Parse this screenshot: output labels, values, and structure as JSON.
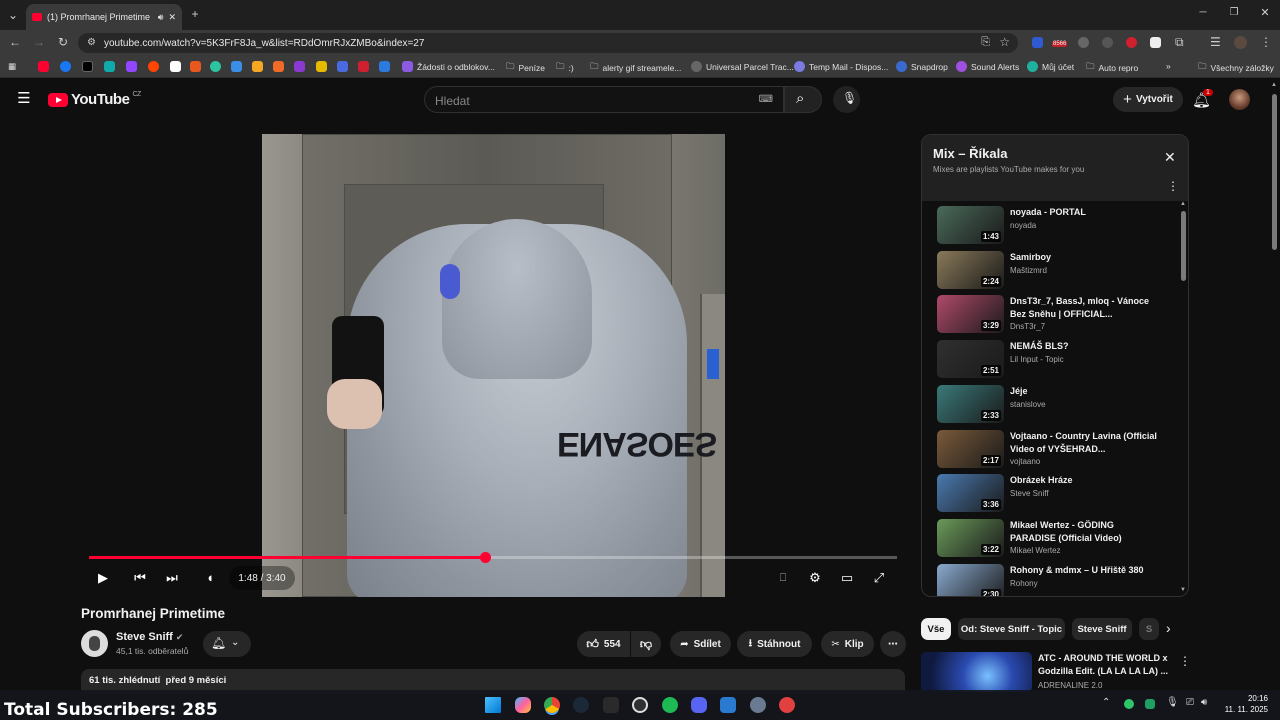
{
  "browser": {
    "tab_title": "(1) Promrhanej Primetime -",
    "url": "youtube.com/watch?v=5K3FrF8Ja_w&list=RDdOmrRJxZMBo&index=27",
    "bookmarks": [
      "Žádosti o odblokov...",
      "Peníze",
      ":)",
      "alerty gif streamele...",
      "Universal Parcel Trac...",
      "Temp Mail - Dispos...",
      "Snapdrop",
      "Sound Alerts",
      "Můj účet",
      "Auto repro"
    ],
    "all_bookmarks": "Všechny záložky",
    "ext_badge": "8566"
  },
  "header": {
    "logo": "YouTube",
    "region": "CZ",
    "search_placeholder": "Hledat",
    "create_label": "Vytvořit",
    "notif_count": "1"
  },
  "player": {
    "time": "1:48 / 3:40",
    "progress": 0.49
  },
  "video": {
    "title": "Promrhanej Primetime",
    "channel": "Steve Sniff",
    "subscribers": "45,1 tis. odběratelů",
    "likes": "554",
    "share": "Sdílet",
    "download": "Stáhnout",
    "clip": "Klip",
    "views": "61 tis. zhlédnutí  před 9 měsíci",
    "hoodie_text": "ENASOES"
  },
  "playlist": {
    "title": "Mix – Říkala",
    "subtitle": "Mixes are playlists YouTube makes for you",
    "items": [
      {
        "title": "noyada - PORTAL",
        "channel": "noyada",
        "duration": "1:43",
        "color": "#4a6a5a"
      },
      {
        "title": "Samirboy",
        "channel": "Maštizmrd",
        "duration": "2:24",
        "color": "#8a7a5a"
      },
      {
        "title": "DnsT3r_7, BassJ, mloq - Vánoce Bez Sněhu | OFFICIAL...",
        "channel": "DnsT3r_7",
        "duration": "3:29",
        "color": "#b04a6a"
      },
      {
        "title": "NEMÁŠ BLS?",
        "channel": "Lil Input - Topic",
        "duration": "2:51",
        "color": "#303030"
      },
      {
        "title": "Jéje",
        "channel": "stanislove",
        "duration": "2:33",
        "color": "#3a7a7a"
      },
      {
        "title": "Vojtaano - Country Lavina (Official Video of VYŠEHRAD...",
        "channel": "vojtaano",
        "duration": "2:17",
        "color": "#7a5a3a"
      },
      {
        "title": "Obrázek Hráze",
        "channel": "Steve Sniff",
        "duration": "3:36",
        "color": "#4a7ab0"
      },
      {
        "title": "Mikael Wertez - GÖDING PARADISE (Official Video)",
        "channel": "Mikael Wertez",
        "duration": "3:22",
        "color": "#6a9a5a"
      },
      {
        "title": "Rohony & mdmx – U Hřiště 380",
        "channel": "Rohony",
        "duration": "2:30",
        "color": "#8aaad0"
      }
    ]
  },
  "chips": [
    "Vše",
    "Od: Steve Sniff - Topic",
    "Steve Sniff",
    "S"
  ],
  "recommended": {
    "title": "ATC - AROUND THE WORLD x Godzilla Edit. (LA LA LA LA) ...",
    "channel": "ADRENALINE 2.0"
  },
  "overlay_text": "Total Subscribers: 285",
  "taskbar": {
    "time": "20:16",
    "date": "11. 11. 2025"
  }
}
